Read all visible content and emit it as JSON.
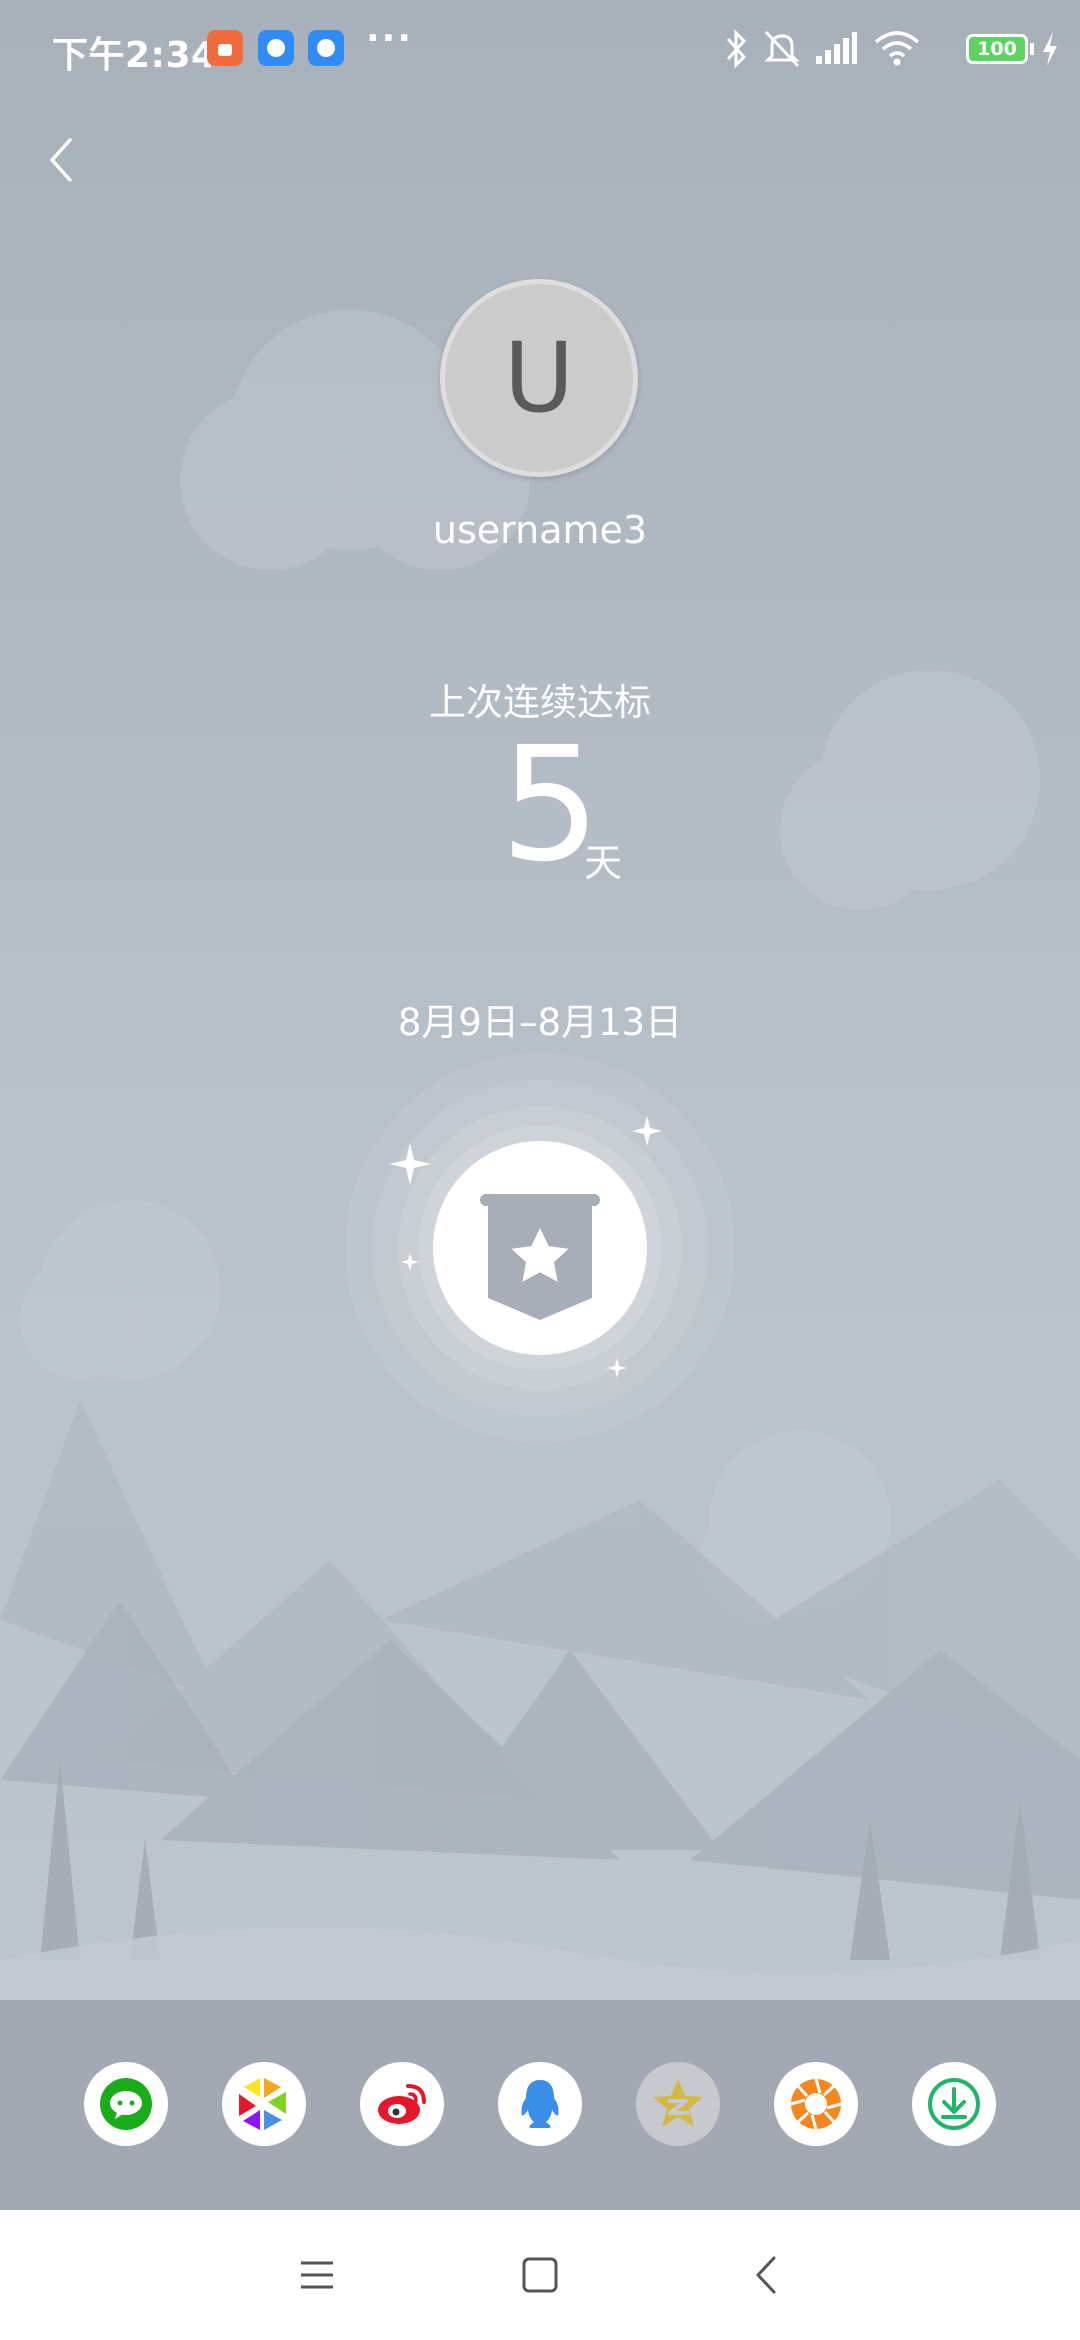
{
  "status_bar": {
    "time": "下午2:34",
    "more": "···",
    "battery": "100",
    "app_icons": [
      "shopping-app-icon",
      "chat-app-icon",
      "chat-app-icon"
    ],
    "right_icons": [
      "bluetooth-icon",
      "mute-icon",
      "signal-icon",
      "wifi-icon",
      "battery-icon",
      "charging-icon"
    ]
  },
  "header": {
    "back_icon": "back-chevron-icon"
  },
  "profile": {
    "avatar_letter": "U",
    "username": "username3"
  },
  "streak": {
    "label": "上次连续达标",
    "days": "5",
    "unit": "天",
    "date_range": "8月9日–8月13日"
  },
  "badge": {
    "icon": "star-banner-badge-icon"
  },
  "share": {
    "targets": [
      {
        "name": "wechat",
        "icon": "wechat-icon",
        "color": "#1aad19"
      },
      {
        "name": "moments",
        "icon": "moments-icon",
        "color": "#f5a623"
      },
      {
        "name": "weibo",
        "icon": "weibo-icon",
        "color": "#e6162d"
      },
      {
        "name": "qq",
        "icon": "qq-icon",
        "color": "#3a8ee6"
      },
      {
        "name": "qzone",
        "icon": "qzone-icon",
        "color": "#d4b845"
      },
      {
        "name": "camera",
        "icon": "aperture-icon",
        "color": "#f5871f"
      },
      {
        "name": "download",
        "icon": "download-icon",
        "color": "#21b46b"
      }
    ]
  },
  "nav_bar": {
    "icons": [
      "menu-icon",
      "home-icon",
      "back-icon"
    ]
  },
  "colors": {
    "background_top": "#a8b0ba",
    "background_bottom": "#bcc4cd",
    "share_bar": "#a2a9b3",
    "text": "#ffffff"
  }
}
